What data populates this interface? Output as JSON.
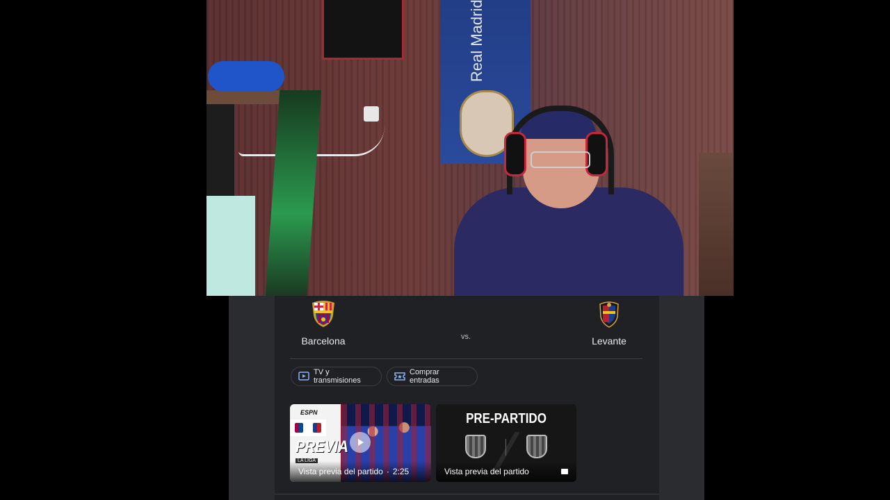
{
  "match": {
    "home_team": "Barcelona",
    "away_team": "Levante",
    "vs_label": "vs."
  },
  "actions": {
    "tv_label": "TV y transmisiones",
    "tickets_label": "Comprar entradas"
  },
  "videos": [
    {
      "source": "ESPN",
      "title_overlay": "PREVIA",
      "league_tag": "LA LIGA",
      "caption": "Vista previa del partido",
      "separator": "·",
      "duration": "2:25"
    },
    {
      "title_overlay": "PRE-PARTIDO",
      "caption": "Vista previa del partido"
    }
  ],
  "webcam": {
    "flag_text": "Real Madrid"
  },
  "colors": {
    "card_bg": "#202124",
    "panel_bg": "#2b2c2f",
    "text": "#e8eaed",
    "accent_icon": "#8ab4f8"
  }
}
